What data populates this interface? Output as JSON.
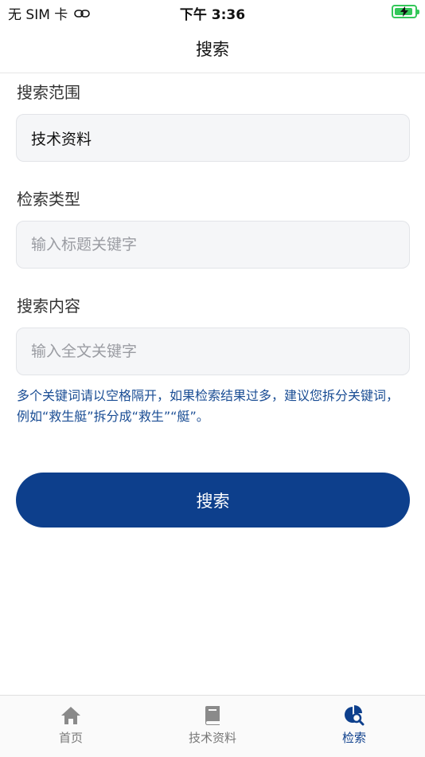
{
  "status_bar": {
    "carrier": "无 SIM 卡",
    "time": "下午 3:36"
  },
  "nav": {
    "title": "搜索"
  },
  "form": {
    "scope_label": "搜索范围",
    "scope_value": "技术资料",
    "type_label": "检索类型",
    "type_placeholder": "输入标题关键字",
    "content_label": "搜索内容",
    "content_placeholder": "输入全文关键字",
    "hint": "多个关键词请以空格隔开，如果检索结果过多，建议您拆分关键词，例如“救生艇”拆分成“救生”“艇”。",
    "submit_label": "搜索"
  },
  "tabs": [
    {
      "label": "首页",
      "icon": "home-icon",
      "active": false
    },
    {
      "label": "技术资料",
      "icon": "book-icon",
      "active": false
    },
    {
      "label": "检索",
      "icon": "search-chart-icon",
      "active": true
    }
  ],
  "colors": {
    "accent": "#0d3f8c",
    "hint_text": "#1a4d94",
    "battery": "#34c759"
  }
}
